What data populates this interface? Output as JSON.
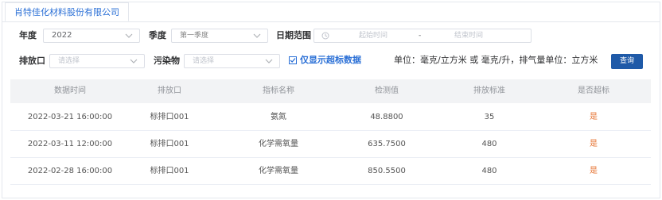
{
  "tab": {
    "label": "肖特佳化材料股份有限公司"
  },
  "filters": {
    "year_label": "年度",
    "year_value": "2022",
    "season_label": "季度",
    "season_value": "第一季度",
    "date_range_label": "日期范围",
    "date_start_placeholder": "起始时间",
    "date_end_placeholder": "结束时间",
    "date_separator": "-",
    "outlet_label": "排放口",
    "outlet_placeholder": "请选择",
    "pollutant_label": "污染物",
    "pollutant_placeholder": "请选择",
    "exceed_only_label": "仅显示超标数据",
    "exceed_only_checked": true,
    "unit_text": "单位：毫克/立方米 或 毫克/升，排气量单位：立方米",
    "query_button": "查询"
  },
  "table": {
    "headers": [
      "数据时间",
      "排放口",
      "指标名称",
      "检测值",
      "排放标准",
      "是否超标"
    ],
    "rows": [
      {
        "time": "2022-03-21 16:00:00",
        "outlet": "标排口001",
        "indicator": "氨氮",
        "value": "48.8800",
        "standard": "35",
        "exceed": "是"
      },
      {
        "time": "2022-03-11 12:00:00",
        "outlet": "标排口001",
        "indicator": "化学需氧量",
        "value": "635.7500",
        "standard": "480",
        "exceed": "是"
      },
      {
        "time": "2022-02-28 16:00:00",
        "outlet": "标排口001",
        "indicator": "化学需氧量",
        "value": "850.5500",
        "standard": "480",
        "exceed": "是"
      }
    ]
  },
  "colors": {
    "accent": "#2a6fd6",
    "button": "#1f5aa8",
    "exceed": "#e6702e",
    "header_bg": "#f2f3f5"
  }
}
